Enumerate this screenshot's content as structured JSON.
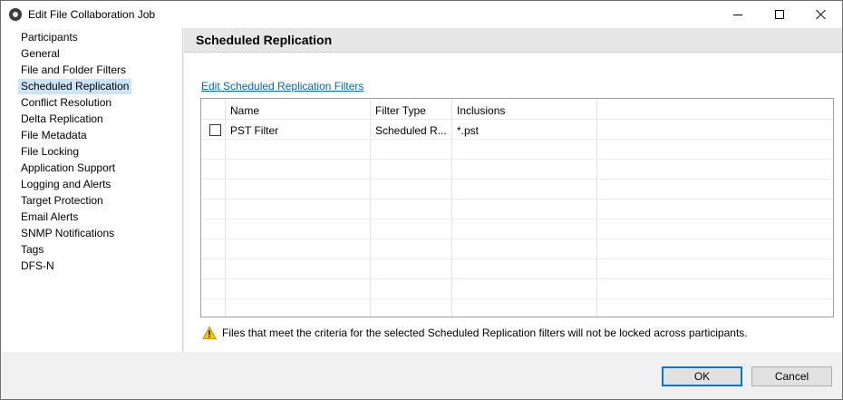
{
  "window": {
    "title": "Edit File Collaboration Job"
  },
  "sidebar": {
    "items": [
      {
        "label": "Participants"
      },
      {
        "label": "General"
      },
      {
        "label": "File and Folder Filters"
      },
      {
        "label": "Scheduled Replication",
        "selected": true
      },
      {
        "label": "Conflict Resolution"
      },
      {
        "label": "Delta Replication"
      },
      {
        "label": "File Metadata"
      },
      {
        "label": "File Locking"
      },
      {
        "label": "Application Support"
      },
      {
        "label": "Logging and Alerts"
      },
      {
        "label": "Target Protection"
      },
      {
        "label": "Email Alerts"
      },
      {
        "label": "SNMP Notifications"
      },
      {
        "label": "Tags"
      },
      {
        "label": "DFS-N"
      }
    ]
  },
  "main": {
    "section_title": "Scheduled Replication",
    "edit_link": "Edit Scheduled Replication Filters",
    "table": {
      "columns": [
        "Name",
        "Filter Type",
        "Inclusions"
      ],
      "rows": [
        {
          "checked": false,
          "name": "PST Filter",
          "filter_type": "Scheduled R...",
          "inclusions": "*.pst"
        }
      ]
    },
    "warning": "Files that meet the criteria for the selected Scheduled Replication filters will not be locked across participants."
  },
  "footer": {
    "ok_label": "OK",
    "cancel_label": "Cancel"
  },
  "colors": {
    "selection": "#cce4f7",
    "link": "#0066cc",
    "warning_icon": "#f5c400"
  }
}
